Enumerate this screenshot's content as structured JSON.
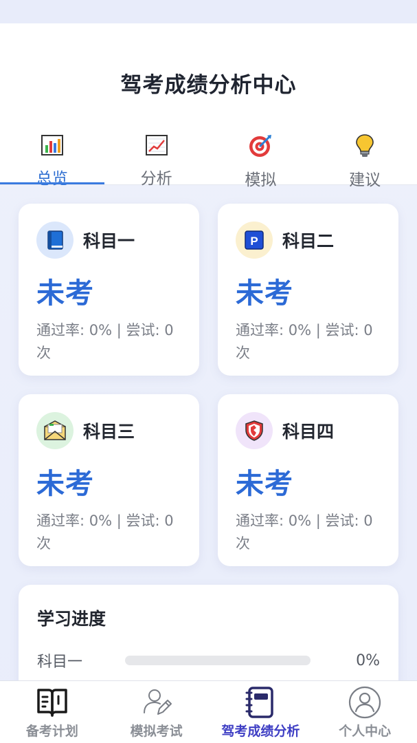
{
  "header": {
    "title": "驾考成绩分析中心"
  },
  "tabs": [
    {
      "label": "总览",
      "icon": "bar-chart-icon",
      "active": true
    },
    {
      "label": "分析",
      "icon": "line-chart-icon",
      "active": false
    },
    {
      "label": "模拟",
      "icon": "target-icon",
      "active": false
    },
    {
      "label": "建议",
      "icon": "lightbulb-icon",
      "active": false
    }
  ],
  "subjects": [
    {
      "name": "科目一",
      "status": "未考",
      "meta": "通过率: 0% | 尝试: 0次",
      "icon": "book-icon"
    },
    {
      "name": "科目二",
      "status": "未考",
      "meta": "通过率: 0% | 尝试: 0次",
      "icon": "parking-icon"
    },
    {
      "name": "科目三",
      "status": "未考",
      "meta": "通过率: 0% | 尝试: 0次",
      "icon": "envelope-icon"
    },
    {
      "name": "科目四",
      "status": "未考",
      "meta": "通过率: 0% | 尝试: 0次",
      "icon": "shield-icon"
    }
  ],
  "progress": {
    "title": "学习进度",
    "rows": [
      {
        "label": "科目一",
        "value": "0%",
        "fraction": 0
      }
    ]
  },
  "bottom_nav": [
    {
      "label": "备考计划",
      "icon": "study-plan-icon",
      "active": false
    },
    {
      "label": "模拟考试",
      "icon": "exam-pen-icon",
      "active": false
    },
    {
      "label": "驾考成绩分析",
      "icon": "notebook-icon",
      "active": true
    },
    {
      "label": "个人中心",
      "icon": "user-icon",
      "active": false
    }
  ],
  "colors": {
    "accent": "#2c6ad6",
    "nav_active": "#3f3fc4",
    "muted": "#7a7e87"
  }
}
